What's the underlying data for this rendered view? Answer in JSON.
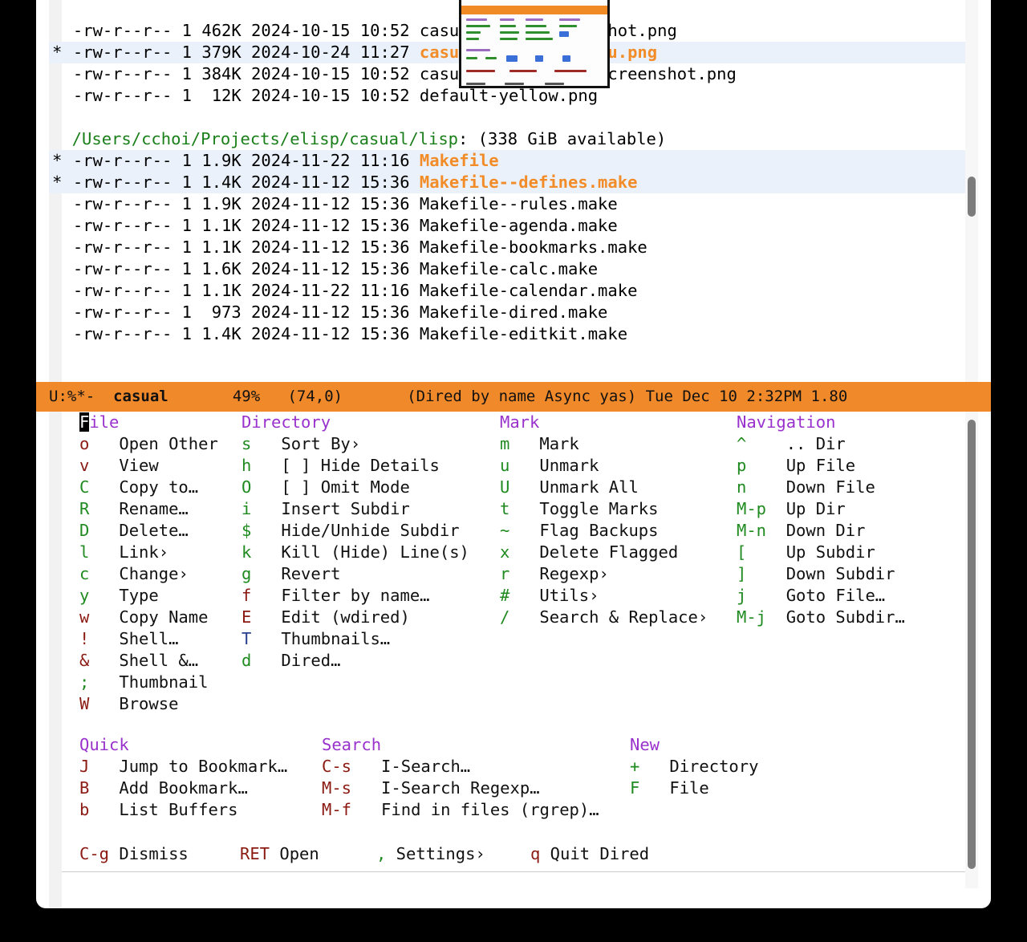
{
  "window": {
    "background_color": "#000000",
    "frame_color": "#ffffff"
  },
  "dired": {
    "lines": [
      {
        "mark": " ",
        "perms": "-rw-r--r--",
        "links": "1",
        "size": "462K",
        "date": "2024-10-15",
        "time": "10:52",
        "name": "casual-info-screenshot.png",
        "marked": false
      },
      {
        "mark": "*",
        "perms": "-rw-r--r--",
        "links": "1",
        "size": "379K",
        "date": "2024-10-24",
        "time": "11:27",
        "name": "casual-isearch-tmenu.png",
        "marked": true
      },
      {
        "mark": " ",
        "perms": "-rw-r--r--",
        "links": "1",
        "size": "384K",
        "date": "2024-10-15",
        "time": "10:52",
        "name": "casual-re-builder-screenshot.png",
        "marked": false
      },
      {
        "mark": " ",
        "perms": "-rw-r--r--",
        "links": "1",
        "size": " 12K",
        "date": "2024-10-15",
        "time": "10:52",
        "name": "default-yellow.png",
        "marked": false
      }
    ],
    "subdir_header": {
      "path": "/Users/cchoi/Projects/elisp/casual/lisp",
      "suffix": ": (338 GiB available)"
    },
    "lines2": [
      {
        "mark": "*",
        "perms": "-rw-r--r--",
        "links": "1",
        "size": "1.9K",
        "date": "2024-11-22",
        "time": "11:16",
        "name": "Makefile",
        "marked": true
      },
      {
        "mark": "*",
        "perms": "-rw-r--r--",
        "links": "1",
        "size": "1.4K",
        "date": "2024-11-12",
        "time": "15:36",
        "name": "Makefile--defines.make",
        "marked": true
      },
      {
        "mark": " ",
        "perms": "-rw-r--r--",
        "links": "1",
        "size": "1.9K",
        "date": "2024-11-12",
        "time": "15:36",
        "name": "Makefile--rules.make",
        "marked": false
      },
      {
        "mark": " ",
        "perms": "-rw-r--r--",
        "links": "1",
        "size": "1.1K",
        "date": "2024-11-12",
        "time": "15:36",
        "name": "Makefile-agenda.make",
        "marked": false
      },
      {
        "mark": " ",
        "perms": "-rw-r--r--",
        "links": "1",
        "size": "1.1K",
        "date": "2024-11-12",
        "time": "15:36",
        "name": "Makefile-bookmarks.make",
        "marked": false
      },
      {
        "mark": " ",
        "perms": "-rw-r--r--",
        "links": "1",
        "size": "1.6K",
        "date": "2024-11-12",
        "time": "15:36",
        "name": "Makefile-calc.make",
        "marked": false
      },
      {
        "mark": " ",
        "perms": "-rw-r--r--",
        "links": "1",
        "size": "1.1K",
        "date": "2024-11-22",
        "time": "11:16",
        "name": "Makefile-calendar.make",
        "marked": false
      },
      {
        "mark": " ",
        "perms": "-rw-r--r--",
        "links": "1",
        "size": " 973",
        "date": "2024-11-12",
        "time": "15:36",
        "name": "Makefile-dired.make",
        "marked": false
      },
      {
        "mark": " ",
        "perms": "-rw-r--r--",
        "links": "1",
        "size": "1.4K",
        "date": "2024-11-12",
        "time": "15:36",
        "name": "Makefile-editkit.make",
        "marked": false
      }
    ],
    "thumbnail_label": "casual-info-screenshot-thumbnail"
  },
  "modeline": {
    "status": "U:%*-",
    "buffer": "casual",
    "percent": "49%",
    "position": "(74,0)",
    "modes": "(Dired by name Async yas) Tue Dec 10 2:32PM 1.80",
    "background": "#f0892a"
  },
  "menu": {
    "groups": [
      {
        "title": "File",
        "title_cursor": "F",
        "title_rest": "ile",
        "items": [
          {
            "key": "o",
            "keycolor": "red",
            "label": "Open Other"
          },
          {
            "key": "v",
            "keycolor": "red",
            "label": "View"
          },
          {
            "key": "C",
            "keycolor": "green",
            "label": "Copy to…"
          },
          {
            "key": "R",
            "keycolor": "green",
            "label": "Rename…"
          },
          {
            "key": "D",
            "keycolor": "green",
            "label": "Delete…"
          },
          {
            "key": "l",
            "keycolor": "green",
            "label": "Link›"
          },
          {
            "key": "c",
            "keycolor": "green",
            "label": "Change›"
          },
          {
            "key": "y",
            "keycolor": "green",
            "label": "Type"
          },
          {
            "key": "w",
            "keycolor": "red",
            "label": "Copy Name"
          },
          {
            "key": "!",
            "keycolor": "red",
            "label": "Shell…"
          },
          {
            "key": "&",
            "keycolor": "red",
            "label": "Shell &…"
          },
          {
            "key": ";",
            "keycolor": "green",
            "label": "Thumbnail"
          },
          {
            "key": "W",
            "keycolor": "red",
            "label": "Browse"
          }
        ]
      },
      {
        "title": "Directory",
        "items": [
          {
            "key": "s",
            "keycolor": "green",
            "label": "Sort By›"
          },
          {
            "key": "h",
            "keycolor": "green",
            "label": "[ ] Hide Details"
          },
          {
            "key": "O",
            "keycolor": "green",
            "label": "[ ] Omit Mode"
          },
          {
            "key": "i",
            "keycolor": "green",
            "label": "Insert Subdir"
          },
          {
            "key": "$",
            "keycolor": "green",
            "label": "Hide/Unhide Subdir"
          },
          {
            "key": "k",
            "keycolor": "green",
            "label": "Kill (Hide) Line(s)"
          },
          {
            "key": "g",
            "keycolor": "green",
            "label": "Revert"
          },
          {
            "key": "f",
            "keycolor": "red",
            "label": "Filter by name…"
          },
          {
            "key": "E",
            "keycolor": "red",
            "label": "Edit (wdired)"
          },
          {
            "key": "T",
            "keycolor": "blue",
            "label": "Thumbnails…"
          },
          {
            "key": "d",
            "keycolor": "green",
            "label": "Dired…"
          }
        ]
      },
      {
        "title": "Mark",
        "items": [
          {
            "key": "m",
            "keycolor": "green",
            "label": "Mark"
          },
          {
            "key": "u",
            "keycolor": "green",
            "label": "Unmark"
          },
          {
            "key": "U",
            "keycolor": "green",
            "label": "Unmark All"
          },
          {
            "key": "t",
            "keycolor": "green",
            "label": "Toggle Marks"
          },
          {
            "key": "~",
            "keycolor": "green",
            "label": "Flag Backups"
          },
          {
            "key": "x",
            "keycolor": "green",
            "label": "Delete Flagged"
          },
          {
            "key": "r",
            "keycolor": "green",
            "label": "Regexp›"
          },
          {
            "key": "#",
            "keycolor": "green",
            "label": "Utils›"
          },
          {
            "key": "/",
            "keycolor": "green",
            "label": "Search & Replace›"
          }
        ]
      },
      {
        "title": "Navigation",
        "items": [
          {
            "key": "^",
            "keycolor": "green",
            "label": ".. Dir"
          },
          {
            "key": "p",
            "keycolor": "green",
            "label": "Up File"
          },
          {
            "key": "n",
            "keycolor": "green",
            "label": "Down File"
          },
          {
            "key": "M-p",
            "keycolor": "green",
            "label": "Up Dir"
          },
          {
            "key": "M-n",
            "keycolor": "green",
            "label": "Down Dir"
          },
          {
            "key": "[",
            "keycolor": "green",
            "label": "Up Subdir"
          },
          {
            "key": "]",
            "keycolor": "green",
            "label": "Down Subdir"
          },
          {
            "key": "j",
            "keycolor": "green",
            "label": "Goto File…"
          },
          {
            "key": "M-j",
            "keycolor": "green",
            "label": "Goto Subdir…"
          }
        ]
      },
      {
        "title": "Quick",
        "items": [
          {
            "key": "J",
            "keycolor": "red",
            "label": "Jump to Bookmark…"
          },
          {
            "key": "B",
            "keycolor": "red",
            "label": "Add Bookmark…"
          },
          {
            "key": "b",
            "keycolor": "red",
            "label": "List Buffers"
          }
        ]
      },
      {
        "title": "Search",
        "items": [
          {
            "key": "C-s",
            "keycolor": "red",
            "label": "I-Search…"
          },
          {
            "key": "M-s",
            "keycolor": "red",
            "label": "I-Search Regexp…"
          },
          {
            "key": "M-f",
            "keycolor": "red",
            "label": "Find in files (rgrep)…"
          }
        ]
      },
      {
        "title": "New",
        "items": [
          {
            "key": "+",
            "keycolor": "green",
            "label": "Directory"
          },
          {
            "key": "F",
            "keycolor": "green",
            "label": "File"
          }
        ]
      }
    ],
    "footer": [
      {
        "key": "C-g",
        "keycolor": "red",
        "label": "Dismiss"
      },
      {
        "key": "RET",
        "keycolor": "red",
        "label": "Open"
      },
      {
        "key": ",",
        "keycolor": "green",
        "label": "Settings›"
      },
      {
        "key": "q",
        "keycolor": "red",
        "label": "Quit Dired"
      }
    ]
  },
  "colors": {
    "accent_orange": "#f0892a",
    "marked_file": "#f28c28",
    "dir_header": "#1a7f1a",
    "group_title": "#9932cc",
    "key_green": "#1f8a1f",
    "key_red": "#8b1a12",
    "key_blue": "#2b3f8f",
    "row_highlight": "#eaf1fb"
  }
}
